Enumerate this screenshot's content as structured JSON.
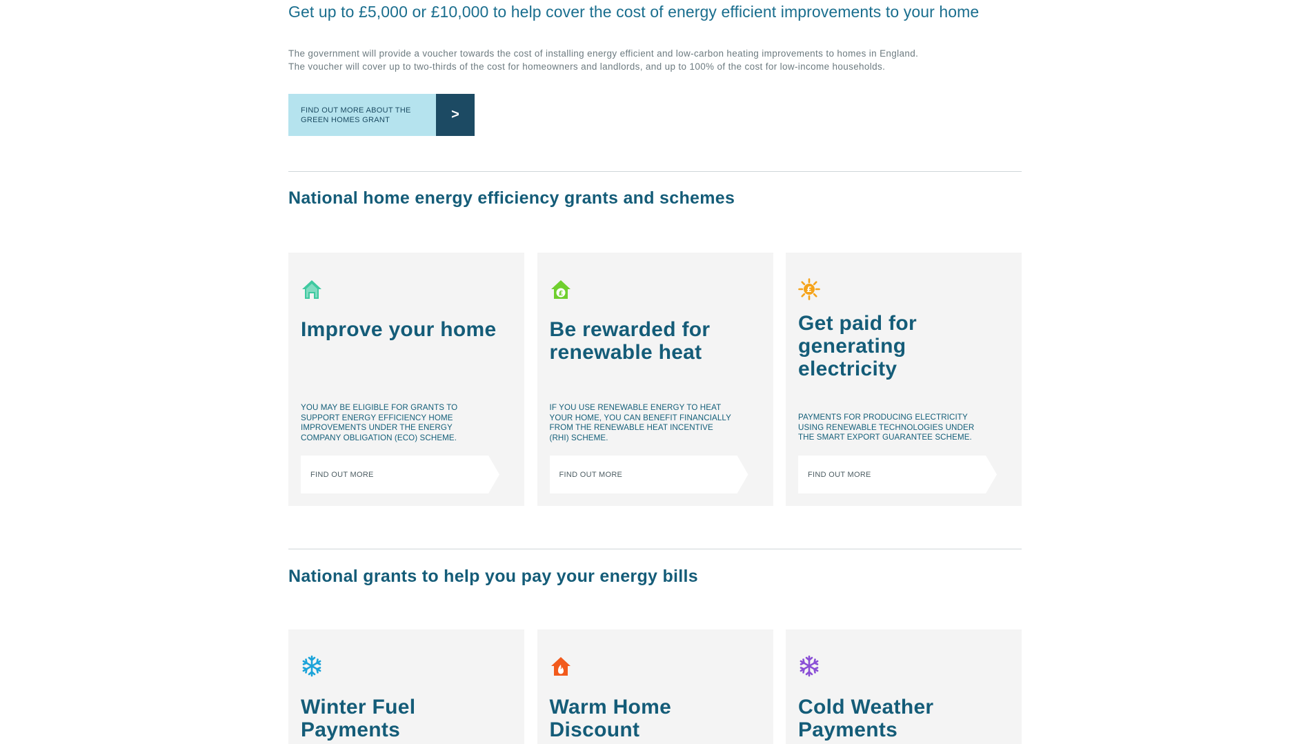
{
  "intro": {
    "title": "Get up to £5,000 or £10,000 to help cover the cost of energy efficient improvements to your home",
    "text_line1": "The government will provide a voucher towards the cost of installing energy efficient and low-carbon heating improvements to homes in England.",
    "text_line2": "The voucher will cover up to two-thirds of the cost for homeowners and landlords, and up to 100% of the cost for low-income households.",
    "cta_label": "FIND OUT MORE ABOUT THE GREEN HOMES GRANT",
    "cta_arrow": ">"
  },
  "section1": {
    "title": "National home energy efficiency grants and schemes",
    "cards": [
      {
        "icon": "house-icon",
        "icon_color": "#3ec9a0",
        "title": "Improve your home",
        "text": "YOU MAY BE ELIGIBLE FOR GRANTS TO SUPPORT ENERGY EFFICIENCY HOME IMPROVEMENTS UNDER THE ENERGY COMPANY OBLIGATION (ECO) SCHEME.",
        "link": "FIND OUT MORE"
      },
      {
        "icon": "house-pound-icon",
        "icon_color": "#6fcf2e",
        "title": "Be rewarded for renewable heat",
        "text": "IF YOU USE RENEWABLE ENERGY TO HEAT YOUR HOME, YOU CAN BENEFIT FINANCIALLY FROM THE RENEWABLE HEAT INCENTIVE (RHI) SCHEME.",
        "link": "FIND OUT MORE"
      },
      {
        "icon": "sun-pound-icon",
        "icon_color": "#f5a31a",
        "title": "Get paid for generating electricity",
        "text": "PAYMENTS FOR PRODUCING ELECTRICITY USING RENEWABLE TECHNOLOGIES UNDER THE SMART EXPORT GUARANTEE SCHEME.",
        "link": "FIND OUT MORE"
      }
    ]
  },
  "section2": {
    "title": "National grants to help you pay your energy bills",
    "cards": [
      {
        "icon": "snowflake-icon",
        "icon_color": "#1aa3d9",
        "title": "Winter Fuel Payments"
      },
      {
        "icon": "house-flame-icon",
        "icon_color": "#f25a1c",
        "title": "Warm Home Discount"
      },
      {
        "icon": "snowflake-icon",
        "icon_color": "#8a4fd6",
        "title": "Cold Weather Payments"
      }
    ]
  }
}
